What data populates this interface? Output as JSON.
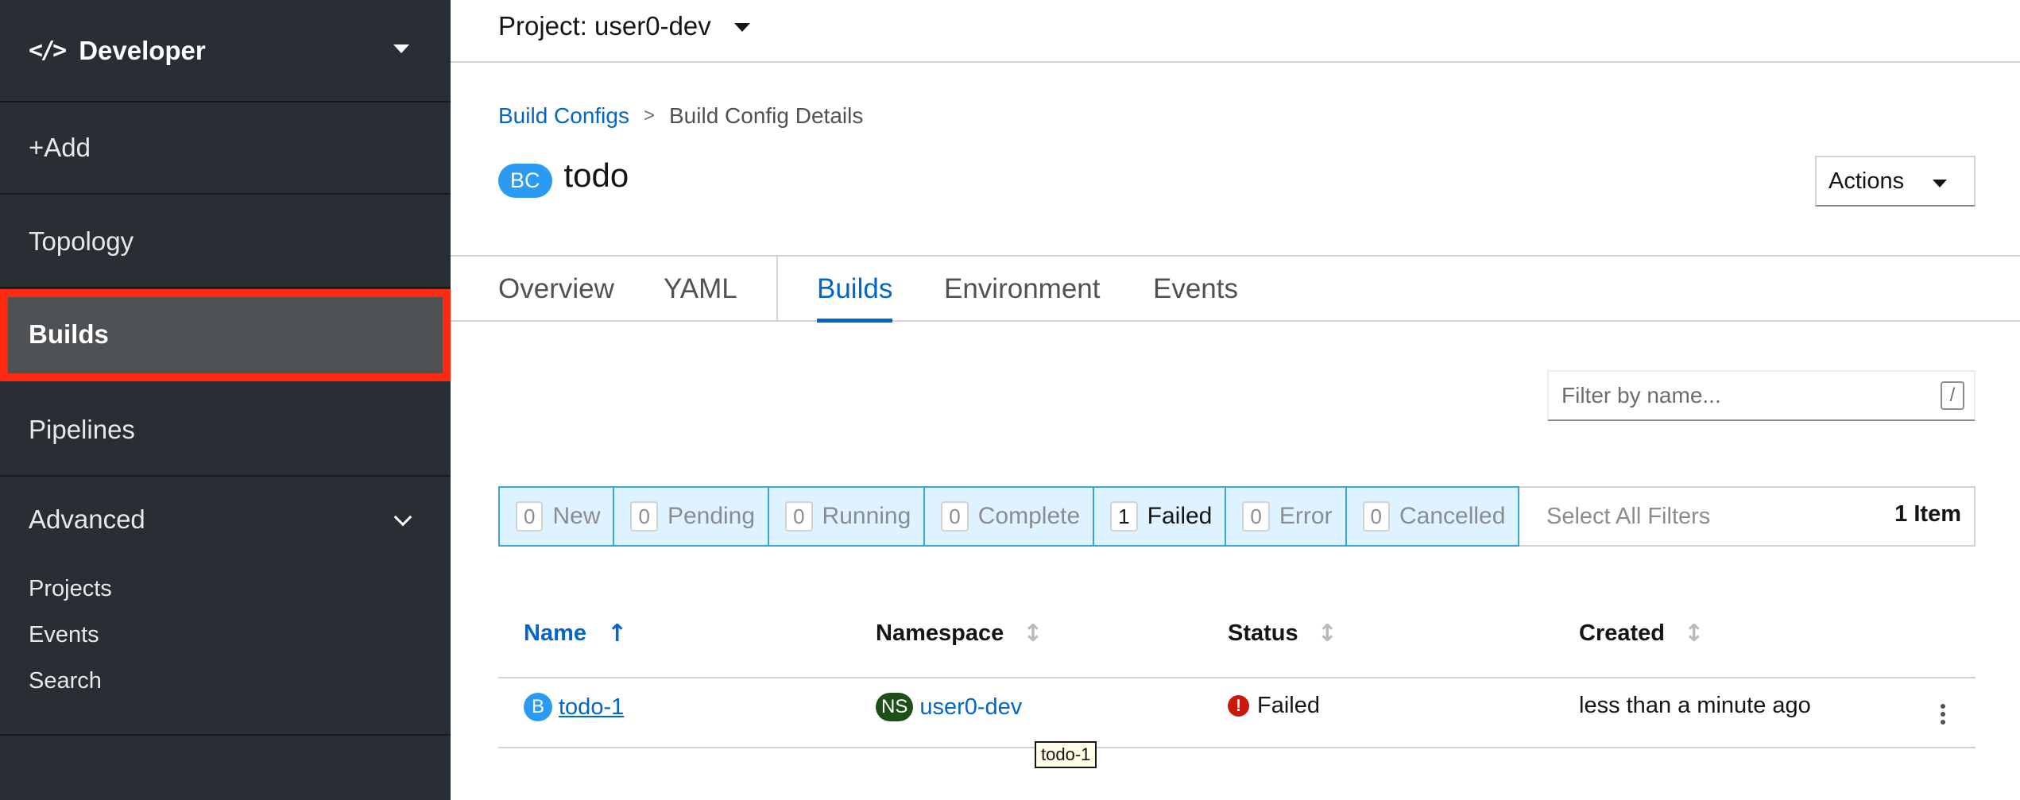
{
  "sidebar": {
    "perspective": {
      "icon": "code-icon",
      "label": "Developer"
    },
    "nav": {
      "add": "+Add",
      "topology": "Topology",
      "builds": "Builds",
      "pipelines": "Pipelines"
    },
    "advanced": {
      "label": "Advanced",
      "items": [
        "Projects",
        "Events",
        "Search"
      ]
    }
  },
  "project_bar": {
    "label": "Project: user0-dev"
  },
  "breadcrumb": {
    "parent": "Build Configs",
    "separator": ">",
    "current": "Build Config Details"
  },
  "header": {
    "kind_badge": "BC",
    "title": "todo",
    "actions_label": "Actions"
  },
  "tabs": [
    "Overview",
    "YAML",
    "Builds",
    "Environment",
    "Events"
  ],
  "active_tab": "Builds",
  "filter": {
    "placeholder": "Filter by name...",
    "shortcut": "/"
  },
  "status_filters": [
    {
      "count": "0",
      "label": "New"
    },
    {
      "count": "0",
      "label": "Pending"
    },
    {
      "count": "0",
      "label": "Running"
    },
    {
      "count": "0",
      "label": "Complete"
    },
    {
      "count": "1",
      "label": "Failed"
    },
    {
      "count": "0",
      "label": "Error"
    },
    {
      "count": "0",
      "label": "Cancelled"
    }
  ],
  "select_all_label": "Select All Filters",
  "item_count": "1 Item",
  "table": {
    "columns": [
      "Name",
      "Namespace",
      "Status",
      "Created"
    ],
    "rows": [
      {
        "badge": "B",
        "name": "todo-1",
        "ns_badge": "NS",
        "namespace": "user0-dev",
        "status": "Failed",
        "created": "less than a minute ago"
      }
    ]
  },
  "tooltip": "todo-1",
  "colors": {
    "sidebar_bg": "#292e34",
    "active_nav_bg": "#4f5255",
    "highlight": "#ff2a12",
    "link": "#0066cc",
    "error": "#c9190b"
  }
}
